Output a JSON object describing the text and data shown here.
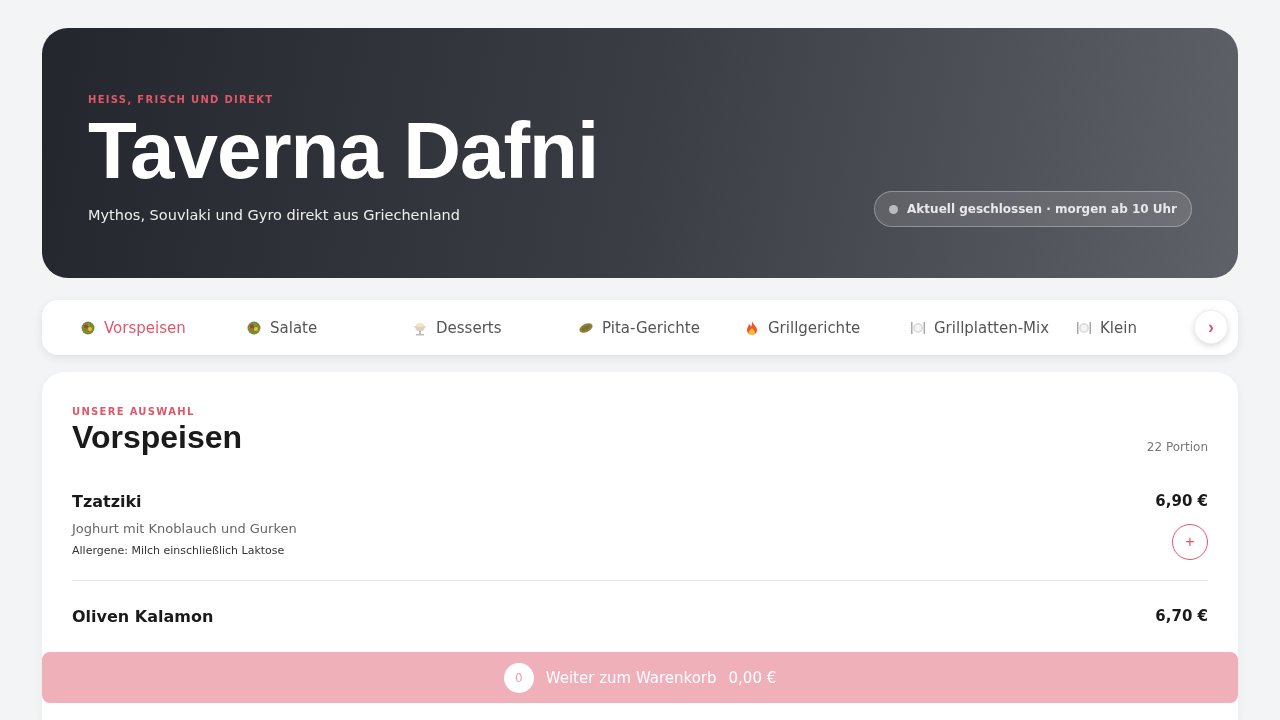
{
  "hero": {
    "eyebrow": "HEISS, FRISCH UND DIREKT",
    "title": "Taverna Dafni",
    "subtitle": "Mythos, Souvlaki und Gyro direkt aus Griechenland",
    "status": {
      "open": false,
      "text": "Aktuell geschlossen · morgen ab 10 Uhr"
    }
  },
  "categories": [
    {
      "label": "Vorspeisen",
      "kind": "salad",
      "selected": true
    },
    {
      "label": "Salate",
      "kind": "salad",
      "selected": false
    },
    {
      "label": "Desserts",
      "kind": "dessert",
      "selected": false
    },
    {
      "label": "Pita-Gerichte",
      "kind": "pita",
      "selected": false
    },
    {
      "label": "Grillgerichte",
      "kind": "fire",
      "selected": false
    },
    {
      "label": "Grillplatten-Mix",
      "kind": "plate",
      "selected": false
    },
    {
      "label": "Klein",
      "kind": "plate",
      "selected": false
    }
  ],
  "next_button": "›",
  "section": {
    "eyebrow": "UNSERE AUSWAHL",
    "title": "Vorspeisen",
    "count": "22 Portion",
    "items": [
      {
        "name": "Tzatziki",
        "description": "Joghurt mit Knoblauch und Gurken",
        "allergens": "Allergene: Milch einschließlich Laktose",
        "price": "6,90 €",
        "add": "+"
      },
      {
        "name": "Oliven Kalamon",
        "price": "6,70 €"
      }
    ]
  },
  "cart": {
    "count": "0",
    "label": "Weiter zum Warenkorb",
    "total": "0,00 €"
  }
}
